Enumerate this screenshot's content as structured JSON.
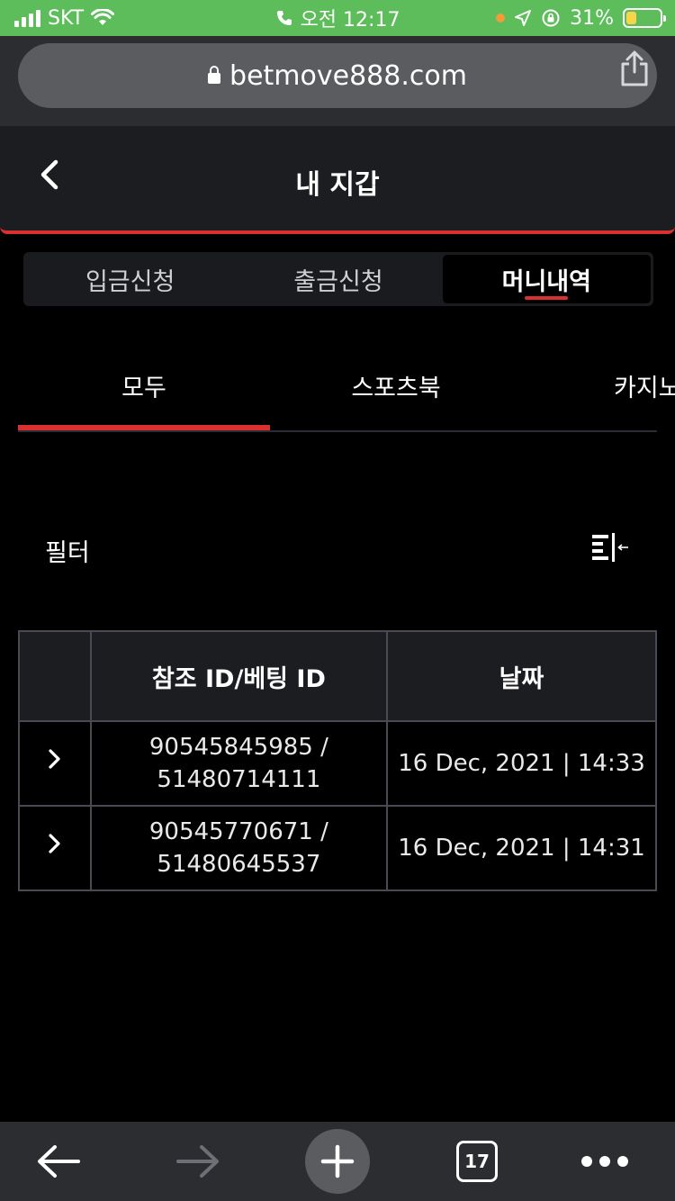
{
  "status_bar": {
    "carrier": "SKT",
    "time": "오전 12:17",
    "battery": "31%",
    "battery_level": 0.31
  },
  "browser": {
    "url": "betmove888.com",
    "tab_count": "17"
  },
  "header": {
    "title": "내 지갑"
  },
  "wallet_tabs": [
    {
      "label": "입금신청",
      "active": false
    },
    {
      "label": "출금신청",
      "active": false
    },
    {
      "label": "머니내역",
      "active": true
    }
  ],
  "sub_tabs": [
    {
      "label": "모두",
      "active": true
    },
    {
      "label": "스포츠북",
      "active": false
    },
    {
      "label": "카지노",
      "active": false
    }
  ],
  "filter": {
    "label": "필터"
  },
  "table": {
    "headers": [
      "참조 ID/베팅 ID",
      "날짜"
    ],
    "rows": [
      {
        "ref_id": "90545845985 /",
        "bet_id": "51480714111",
        "date": "16 Dec, 2021 | 14:33"
      },
      {
        "ref_id": "90545770671 /",
        "bet_id": "51480645537",
        "date": "16 Dec, 2021 | 14:31"
      }
    ]
  },
  "colors": {
    "accent": "#d8312f",
    "status_bar": "#5cbd5a",
    "panel": "#1c1d21",
    "background": "#000000"
  }
}
